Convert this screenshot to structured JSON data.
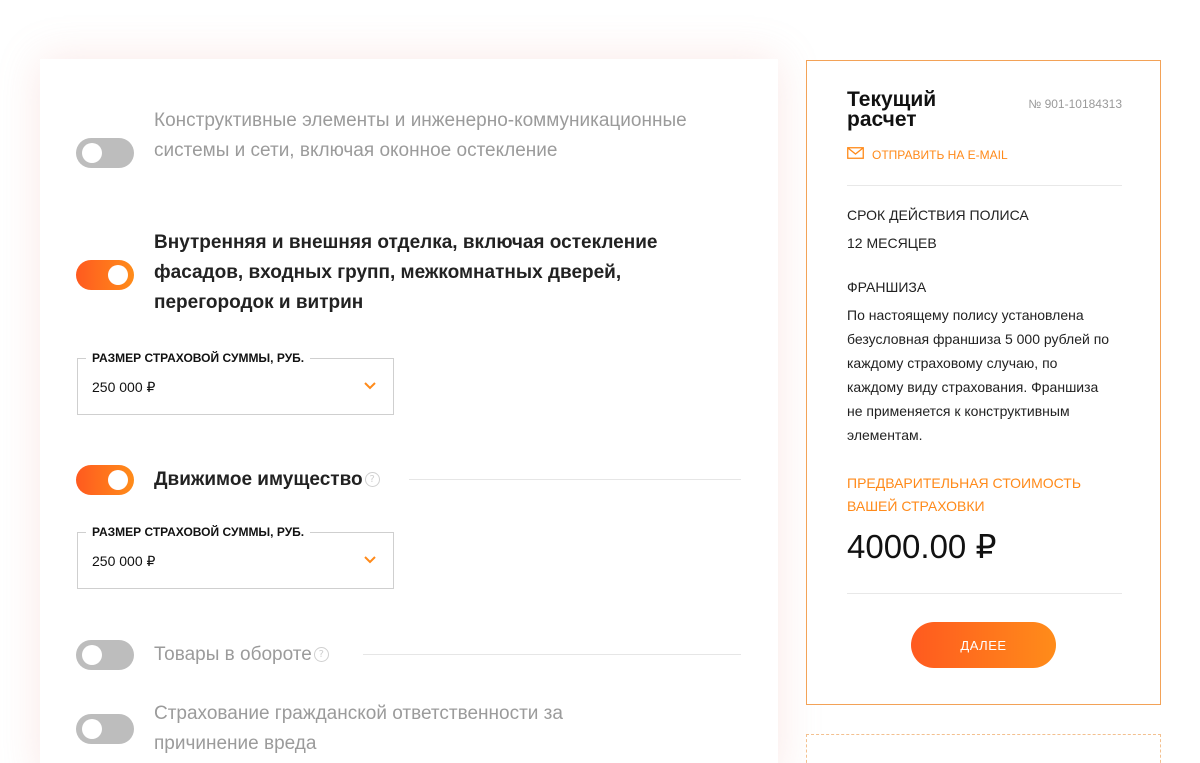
{
  "options": [
    {
      "label": "Конструктивные элементы и инженерно-коммуникационные системы и сети, включая оконное остекление",
      "enabled": false
    },
    {
      "label": "Внутренняя и внешняя отделка, включая остекление фасадов, входных групп, межкомнатных дверей, перегородок и витрин",
      "enabled": true,
      "sum_field": {
        "legend": "РАЗМЕР СТРАХОВОЙ СУММЫ, РУБ.",
        "value": "250 000 ₽"
      }
    },
    {
      "label": "Движимое имущество",
      "enabled": true,
      "help": "?",
      "sum_field": {
        "legend": "РАЗМЕР СТРАХОВОЙ СУММЫ, РУБ.",
        "value": "250 000 ₽"
      }
    },
    {
      "label": "Товары в обороте",
      "enabled": false,
      "help": "?"
    },
    {
      "label": "Страхование гражданской ответственности за причинение вреда",
      "enabled": false
    }
  ],
  "summary": {
    "title": "Текущий расчет",
    "number": "№ 901-10184313",
    "email_link": "ОТПРАВИТЬ НА E-MAIL",
    "term_heading": "СРОК ДЕЙСТВИЯ ПОЛИСА",
    "term_value": "12 МЕСЯЦЕВ",
    "franchise_heading": "ФРАНШИЗА",
    "franchise_text": "По настоящему полису установлена безусловная франшиза 5 000 рублей по каждому страховому случаю, по каждому виду страхования. Франшиза не применяется к конструктивным элементам.",
    "price_heading": "ПРЕДВАРИТЕЛЬНАЯ СТОИМОСТЬ ВАШЕЙ СТРАХОВКИ",
    "price": "4000.00 ₽",
    "next_button": "ДАЛЕЕ"
  },
  "colors": {
    "accent": "#ff8a1a",
    "accent_start": "#ff5a1f",
    "toggle_off": "#bdbdbd",
    "muted": "#9b9b9b"
  },
  "icons": {
    "email": "envelope-icon",
    "help": "question-circle-icon",
    "chevron": "chevron-down-icon"
  }
}
